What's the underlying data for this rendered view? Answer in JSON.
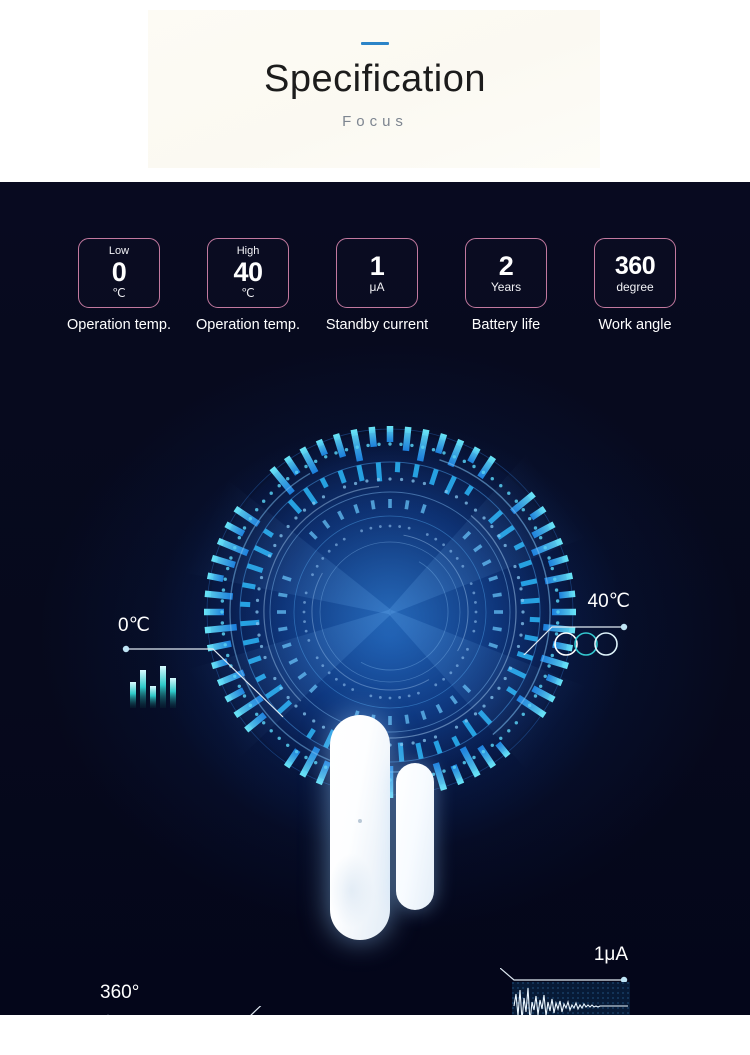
{
  "header": {
    "title": "Specification",
    "subtitle": "Focus",
    "rule_color": "#2b84c8",
    "panel_color": "#fdfbf4"
  },
  "theme": {
    "dark_bg": "#070a1e",
    "badge_border": "#c2799f",
    "accent_cyan": "#29d8ff",
    "accent_blue": "#1b6fd4",
    "text_white": "#ffffff"
  },
  "specs": [
    {
      "top": "Low",
      "value": "0",
      "unit": "℃",
      "caption": "Operation temp."
    },
    {
      "top": "High",
      "value": "40",
      "unit": "℃",
      "caption": "Operation temp."
    },
    {
      "top": "",
      "value": "1",
      "unit": "μA",
      "caption": "Standby current"
    },
    {
      "top": "",
      "value": "2",
      "unit": "Years",
      "caption": "Battery life"
    },
    {
      "top": "",
      "value": "360",
      "unit": "degree",
      "caption": "Work angle"
    }
  ],
  "callouts": [
    {
      "id": "low-temp",
      "label": "0℃",
      "icon": "bar-chart-icon"
    },
    {
      "id": "high-temp",
      "label": "40℃",
      "icon": "three-rings-icon"
    },
    {
      "id": "standby-current",
      "label": "1μA",
      "icon": "waveform-icon"
    },
    {
      "id": "work-angle",
      "label": "360°",
      "icon": "line-graph-icon"
    }
  ],
  "device": {
    "name": "door-window-sensor",
    "parts": [
      "sensor-body",
      "magnet-piece"
    ]
  }
}
